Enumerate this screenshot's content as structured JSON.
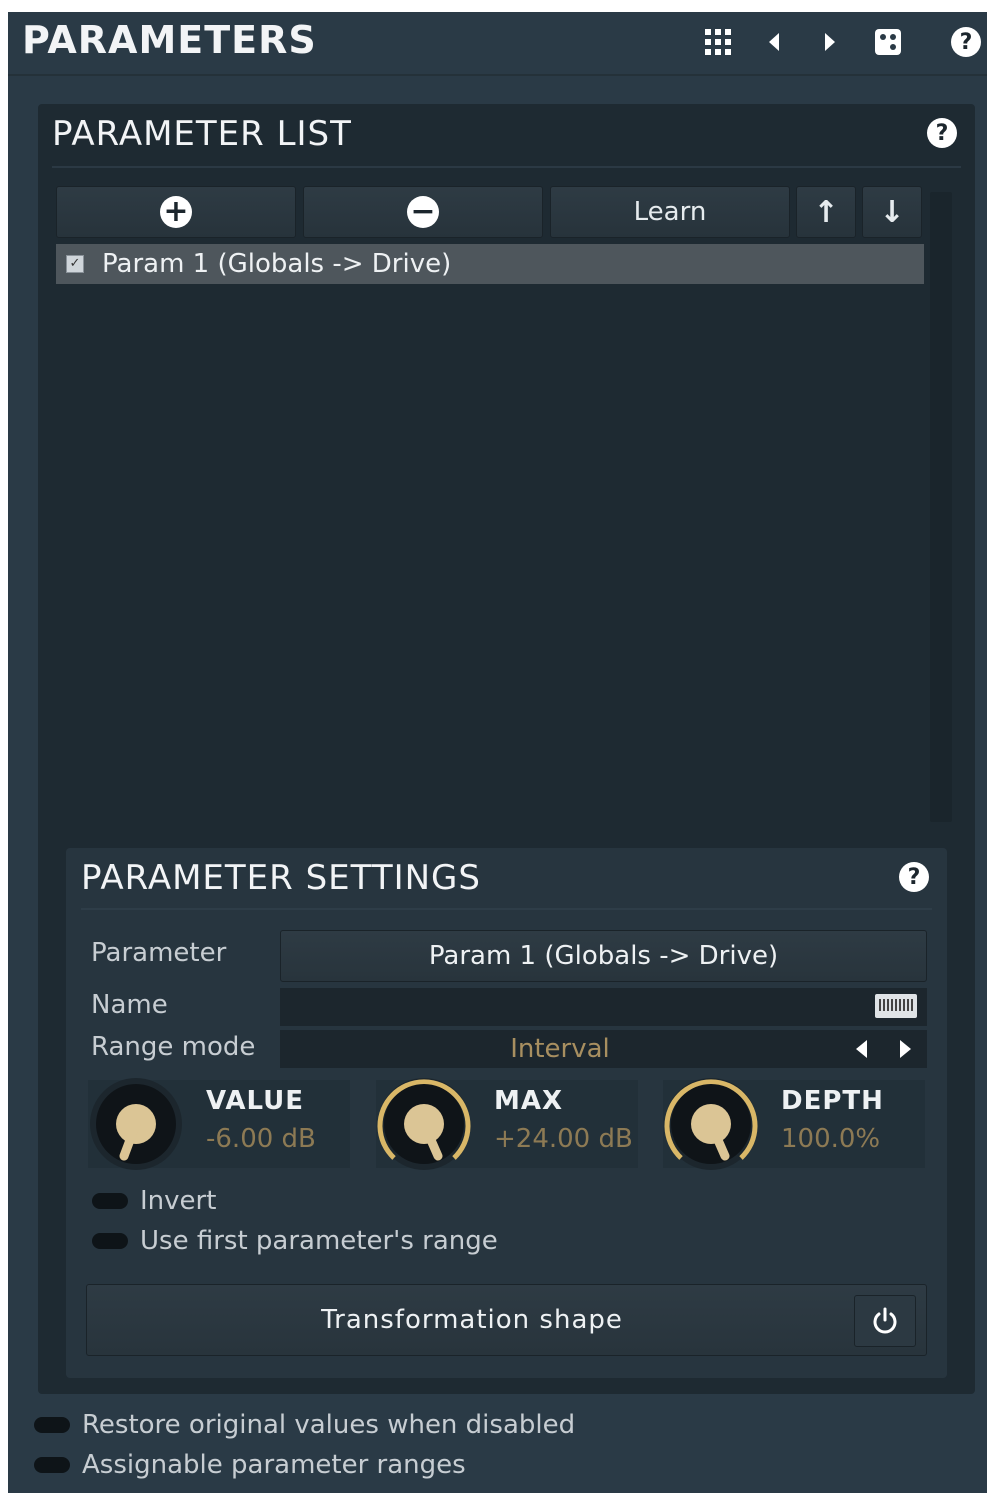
{
  "header": {
    "title": "PARAMETERS",
    "icons": [
      "grid-icon",
      "prev-icon",
      "next-icon",
      "dice-icon",
      "help-icon"
    ],
    "help_glyph": "?"
  },
  "parameter_list": {
    "title": "PARAMETER LIST",
    "help_glyph": "?",
    "toolbar": {
      "add_glyph": "+",
      "remove_glyph": "−",
      "learn_label": "Learn",
      "up_glyph": "↑",
      "down_glyph": "↓"
    },
    "items": [
      {
        "label": "Param 1 (Globals -> Drive)",
        "checked": true
      }
    ]
  },
  "parameter_settings": {
    "title": "PARAMETER SETTINGS",
    "help_glyph": "?",
    "parameter_label": "Parameter",
    "parameter_value": "Param 1 (Globals -> Drive)",
    "name_label": "Name",
    "name_value": "",
    "range_mode_label": "Range mode",
    "range_mode_value": "Interval",
    "knobs": [
      {
        "title": "VALUE",
        "value": "-6.00 dB",
        "active": false
      },
      {
        "title": "MAX",
        "value": "+24.00 dB",
        "active": true
      },
      {
        "title": "DEPTH",
        "value": "100.0%",
        "active": true
      }
    ],
    "invert_label": "Invert",
    "use_first_label": "Use first parameter's range",
    "transform_label": "Transformation shape"
  },
  "footer": {
    "restore_label": "Restore original values when disabled",
    "assignable_label": "Assignable parameter ranges"
  },
  "colors": {
    "background": "#2a3a46",
    "panel": "#1e2a32",
    "accent_gold": "#d9b767",
    "value_text": "#8d7a54"
  }
}
